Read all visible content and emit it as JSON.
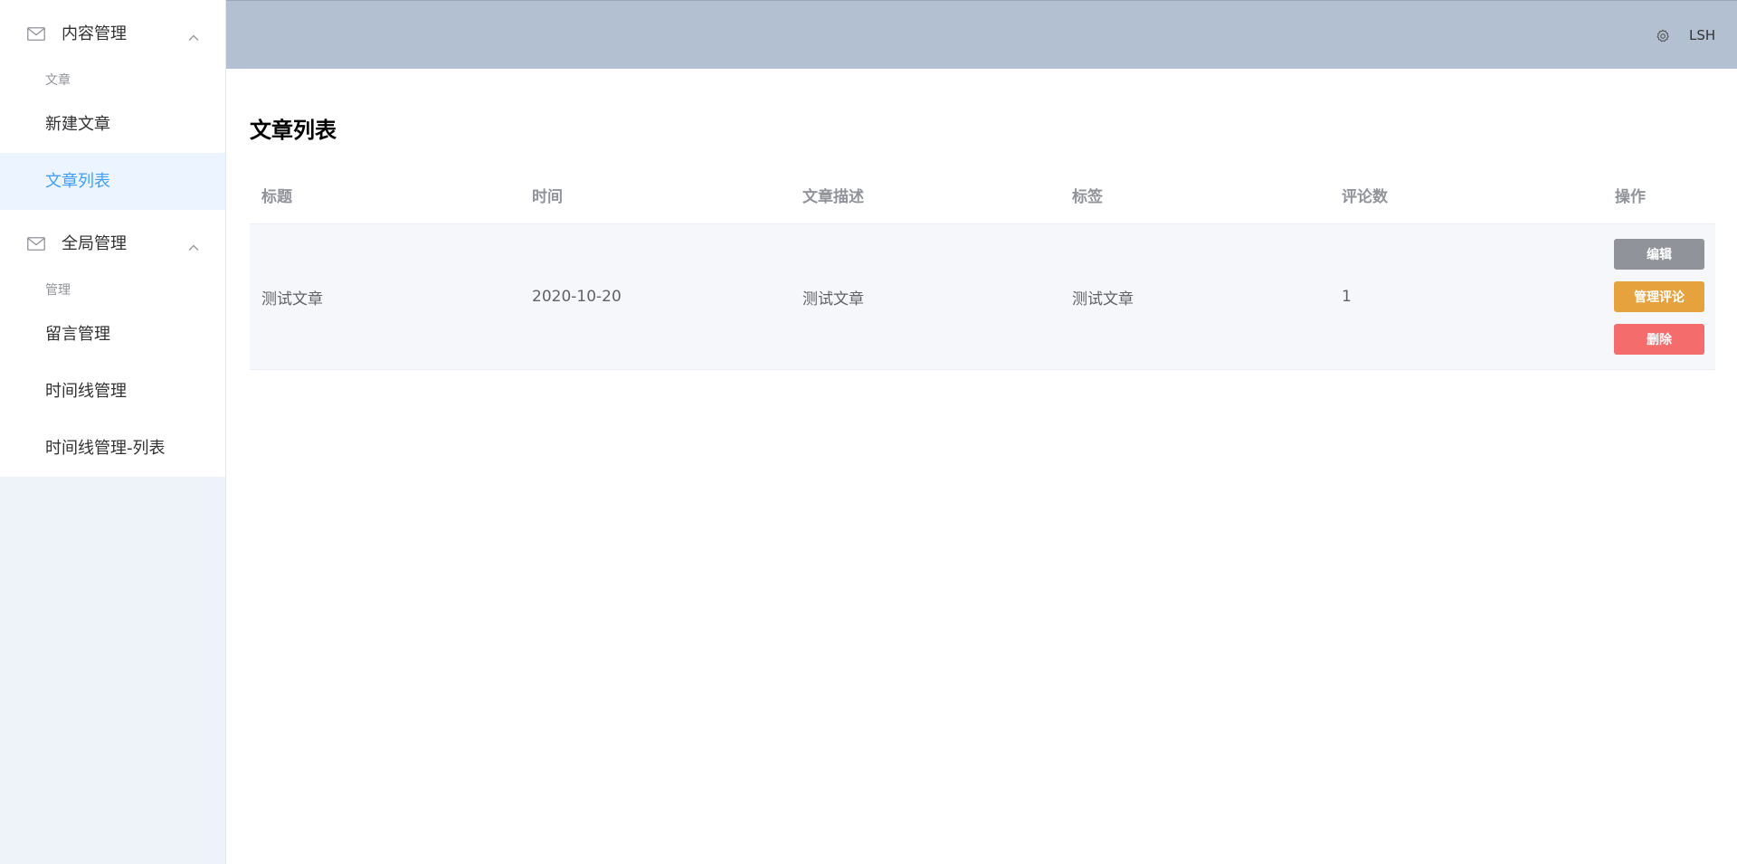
{
  "sidebar": {
    "menus": [
      {
        "title": "内容管理",
        "group": "文章",
        "items": [
          "新建文章",
          "文章列表"
        ]
      },
      {
        "title": "全局管理",
        "group": "管理",
        "items": [
          "留言管理",
          "时间线管理",
          "时间线管理-列表"
        ]
      }
    ],
    "active_item": "文章列表"
  },
  "header": {
    "icon": "gear-icon",
    "username": "LSH"
  },
  "main": {
    "title": "文章列表",
    "table": {
      "columns": [
        "标题",
        "时间",
        "文章描述",
        "标签",
        "评论数",
        "操作"
      ],
      "rows": [
        {
          "title": "测试文章",
          "time": "2020-10-20",
          "description": "测试文章",
          "tag": "测试文章",
          "comments": "1",
          "actions": {
            "edit": "编辑",
            "manage_comments": "管理评论",
            "delete": "删除"
          }
        }
      ]
    }
  },
  "colors": {
    "header_bg": "#b3c0d1",
    "active_text": "#409eff",
    "active_bg": "#ecf5ff",
    "btn_info": "#909399",
    "btn_warning": "#e6a23c",
    "btn_danger": "#f56c6c"
  }
}
